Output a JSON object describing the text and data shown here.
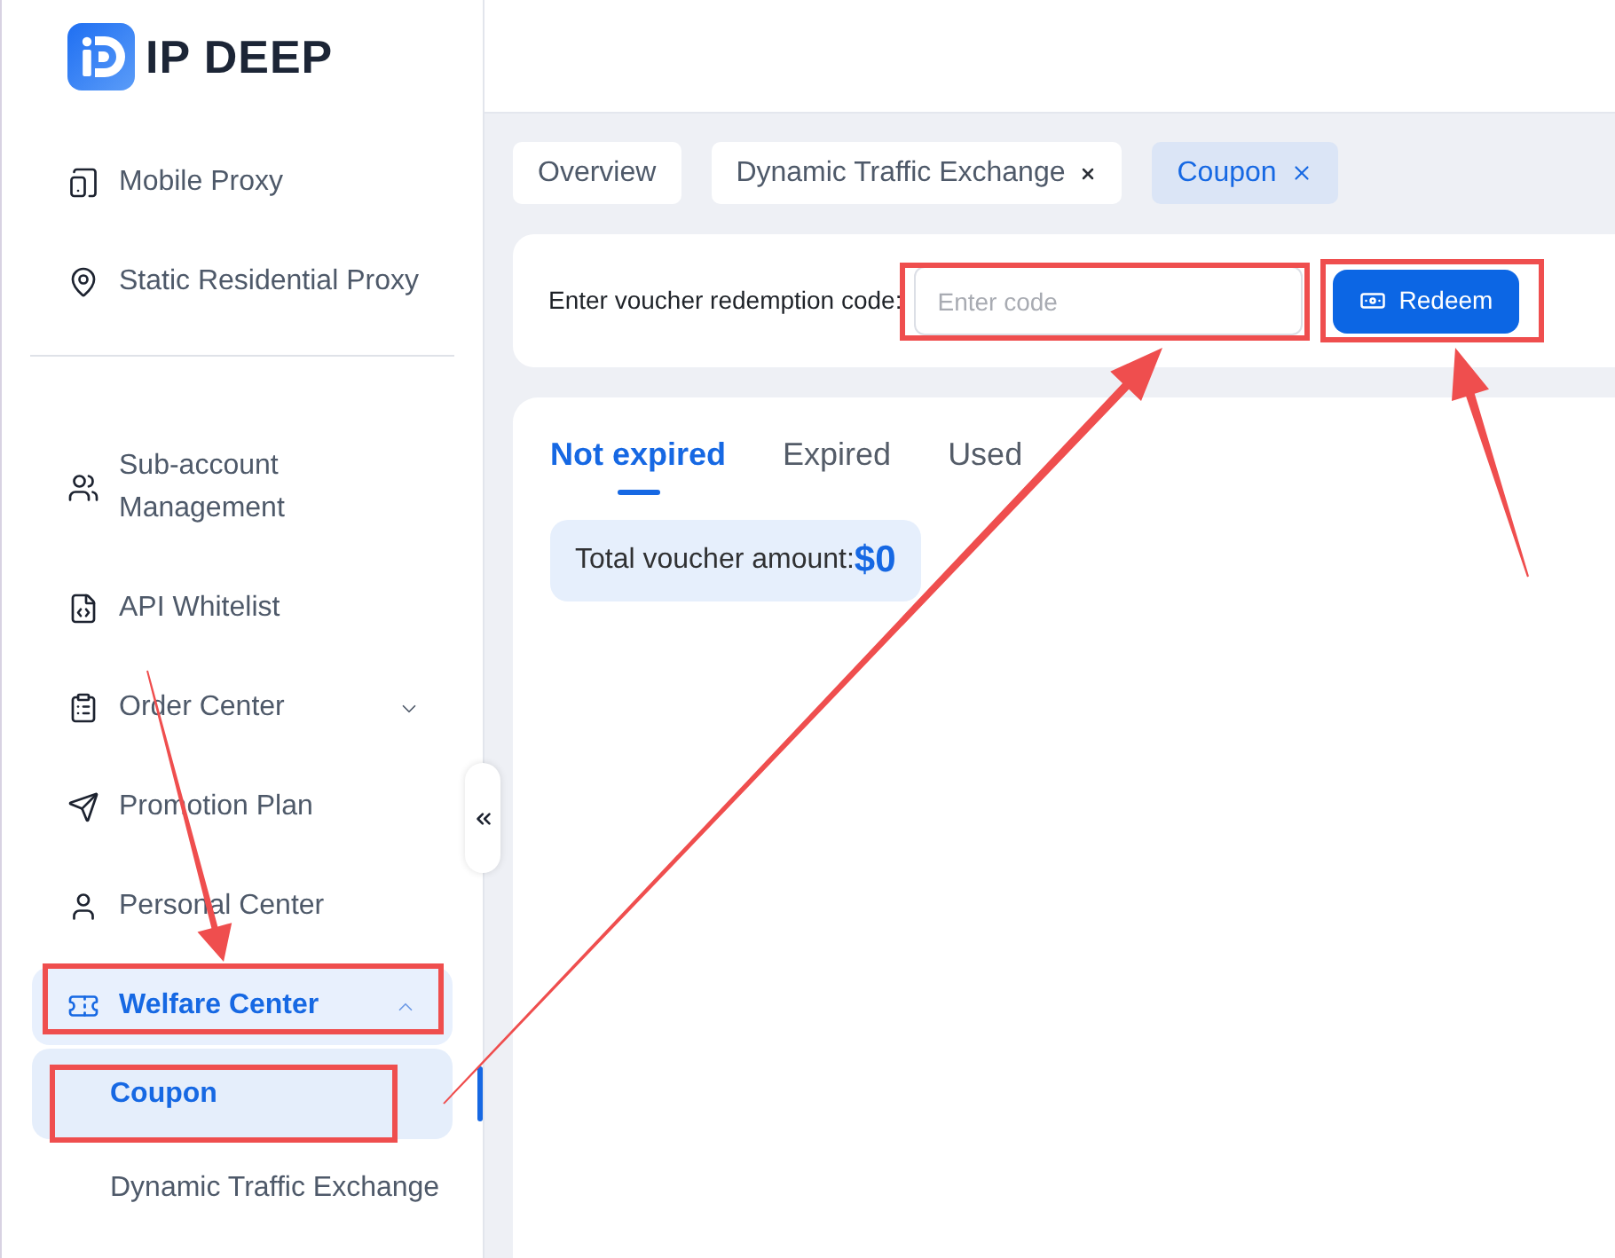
{
  "brand": {
    "name": "IP DEEP"
  },
  "sidebar": {
    "sections": [
      {
        "items": [
          {
            "label": "Mobile Proxy",
            "selected": false
          },
          {
            "label": "Static Residential Proxy",
            "selected": false
          }
        ]
      },
      {
        "items": [
          {
            "label": "Sub-account Management",
            "selected": false
          },
          {
            "label": "API Whitelist",
            "selected": false
          },
          {
            "label": "Order Center",
            "selected": false,
            "expanded": false
          },
          {
            "label": "Promotion Plan",
            "selected": false
          },
          {
            "label": "Personal Center",
            "selected": false
          },
          {
            "label": "Welfare Center",
            "selected": true,
            "expanded": true,
            "children": [
              {
                "label": "Coupon",
                "selected": true
              },
              {
                "label": "Dynamic Traffic Exchange",
                "selected": false
              }
            ]
          }
        ]
      }
    ]
  },
  "page_tabs": [
    {
      "label": "Overview",
      "selected": false,
      "closable": false
    },
    {
      "label": "Dynamic Traffic Exchange",
      "selected": false,
      "closable": true
    },
    {
      "label": "Coupon",
      "selected": true,
      "closable": true
    }
  ],
  "redeem": {
    "label": "Enter voucher redemption code:",
    "placeholder": "Enter code",
    "button": "Redeem"
  },
  "voucher_tabs": [
    {
      "label": "Not expired",
      "selected": true
    },
    {
      "label": "Expired",
      "selected": false
    },
    {
      "label": "Used",
      "selected": false
    }
  ],
  "summary": {
    "label": "Total voucher amount:",
    "value": "$0"
  }
}
